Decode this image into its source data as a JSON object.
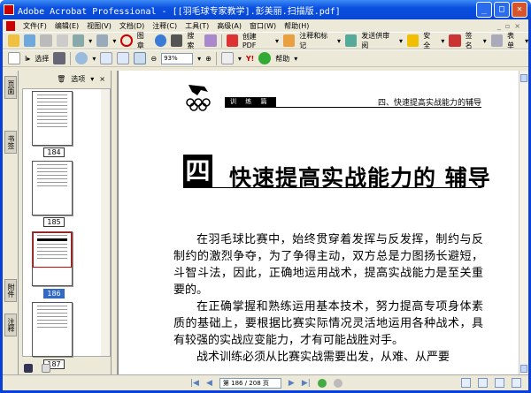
{
  "window": {
    "title": "Adobe Acrobat Professional - [[羽毛球专家教学].彭美丽.扫描版.pdf]",
    "title_display": "Adobe Acrobat Professional - [[羽毛球专家教学].彭美丽.扫描版.pdf]"
  },
  "menu": [
    "文件(F)",
    "编辑(E)",
    "视图(V)",
    "文档(D)",
    "注释(C)",
    "工具(T)",
    "高级(A)",
    "窗口(W)",
    "帮助(H)"
  ],
  "toolbar1": {
    "stamp": "图章",
    "search": "搜索",
    "create_pdf": "创建 PDF",
    "comment": "注释和标记",
    "send_review": "发送供审阅",
    "secure": "安全",
    "sign": "签名",
    "forms": "表单"
  },
  "toolbar2": {
    "select": "选择",
    "zoom": "93%",
    "help": "帮助"
  },
  "sidetabs": [
    "页面",
    "书签",
    "附件",
    "注释"
  ],
  "panel": {
    "options": "选项",
    "close": "×",
    "thumbs": [
      "184",
      "185",
      "186",
      "187"
    ],
    "selected": "186"
  },
  "page": {
    "header_box": "训 练 篇",
    "header_text": "四、快速提高实战能力的辅导",
    "chapter_num": "四",
    "chapter_title": "快速提高实战能力的 辅导",
    "paragraphs": [
      "在羽毛球比赛中，始终贯穿着发挥与反发挥，制约与反制约的激烈争夺，为了争得主动，双方总是力图扬长避短，斗智斗法，因此，正确地运用战术，提高实战能力是至关重要的。",
      "在正确掌握和熟练运用基本技术，努力提高专项身体素质的基础上，要根据比赛实际情况灵活地运用各种战术，具有较强的实战应变能力，才有可能战胜对手。",
      "战术训练必须从比赛实战需要出发，从难、从严要"
    ]
  },
  "status": {
    "page": "第 186 / 208 页"
  }
}
